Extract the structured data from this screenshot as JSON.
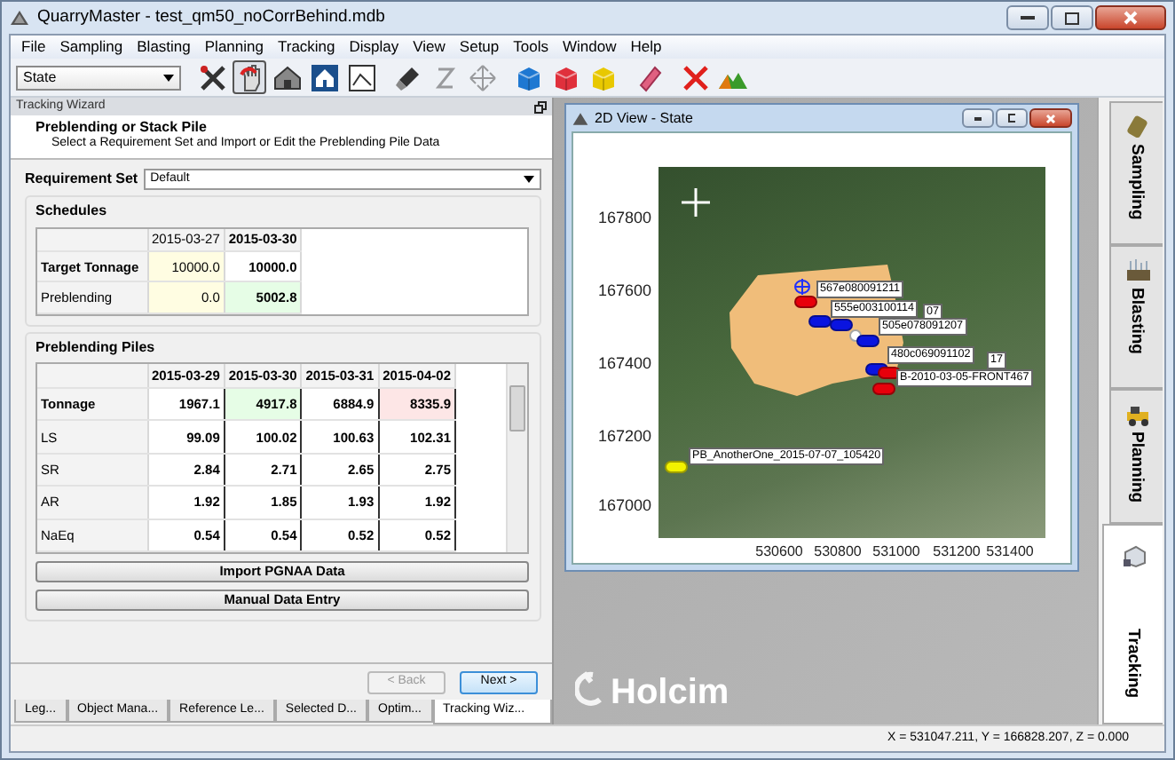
{
  "window": {
    "title": "QuarryMaster - test_qm50_noCorrBehind.mdb"
  },
  "menu": [
    "File",
    "Sampling",
    "Blasting",
    "Planning",
    "Tracking",
    "Display",
    "View",
    "Setup",
    "Tools",
    "Window",
    "Help"
  ],
  "toolbar": {
    "combo": "State",
    "buttons": [
      {
        "kind": "tools",
        "pressed": false,
        "disabled": false
      },
      {
        "kind": "hand",
        "pressed": true,
        "disabled": false
      },
      {
        "kind": "house",
        "pressed": false,
        "disabled": false
      },
      {
        "kind": "house-framed",
        "pressed": false,
        "disabled": false
      },
      {
        "kind": "frame",
        "pressed": false,
        "disabled": false
      },
      {
        "kind": "flashlight",
        "pressed": false,
        "disabled": false
      },
      {
        "kind": "zaxis",
        "pressed": false,
        "disabled": true
      },
      {
        "kind": "move",
        "pressed": false,
        "disabled": true
      },
      {
        "kind": "cube",
        "pressed": false,
        "disabled": false,
        "color": "#1e78d2"
      },
      {
        "kind": "cube",
        "pressed": false,
        "disabled": false,
        "color": "#e0303c"
      },
      {
        "kind": "cube",
        "pressed": false,
        "disabled": false,
        "color": "#e8c800"
      },
      {
        "kind": "eraser",
        "pressed": false,
        "disabled": false
      },
      {
        "kind": "delete",
        "pressed": false,
        "disabled": false
      },
      {
        "kind": "terrain",
        "pressed": false,
        "disabled": false
      }
    ]
  },
  "tracking_wizard": {
    "panel_title": "Tracking Wizard",
    "step_title": "Preblending or Stack Pile",
    "step_description": "Select a Requirement Set and Import or Edit the Preblending Pile Data",
    "requirement_set": {
      "label": "Requirement Set",
      "value": "Default"
    },
    "schedules": {
      "title": "Schedules",
      "columns": [
        {
          "text": "2015-03-27",
          "bold": false
        },
        {
          "text": "2015-03-30",
          "bold": true
        }
      ],
      "rows": [
        {
          "label": "Target Tonnage",
          "bold": true,
          "cells": [
            {
              "text": "10000.0",
              "bold": false,
              "color": "#fffde2"
            },
            {
              "text": "10000.0",
              "bold": true,
              "color": "#ffffff"
            }
          ]
        },
        {
          "label": "Preblending",
          "bold": false,
          "cells": [
            {
              "text": "0.0",
              "bold": false,
              "color": "#fffde2"
            },
            {
              "text": "5002.8",
              "bold": true,
              "color": "#e6fde6"
            }
          ]
        }
      ]
    },
    "piles": {
      "title": "Preblending Piles",
      "columns": [
        {
          "text": "2015-03-29",
          "bold": true
        },
        {
          "text": "2015-03-30",
          "bold": true
        },
        {
          "text": "2015-03-31",
          "bold": true
        },
        {
          "text": "2015-04-02",
          "bold": true
        }
      ],
      "rows": [
        {
          "label": "Tonnage",
          "bold": true,
          "cells": [
            {
              "text": "1967.1",
              "bold": true,
              "color": "#ffffff"
            },
            {
              "text": "4917.8",
              "bold": true,
              "color": "#e6fde6"
            },
            {
              "text": "6884.9",
              "bold": true,
              "color": "#ffffff"
            },
            {
              "text": "8335.9",
              "bold": true,
              "color": "#fde6e6"
            }
          ]
        },
        {
          "label": "LS",
          "bold": false,
          "cells": [
            {
              "text": "99.09",
              "bold": true,
              "color": "#ffffff"
            },
            {
              "text": "100.02",
              "bold": true,
              "color": "#ffffff"
            },
            {
              "text": "100.63",
              "bold": true,
              "color": "#ffffff"
            },
            {
              "text": "102.31",
              "bold": true,
              "color": "#ffffff"
            }
          ]
        },
        {
          "label": "SR",
          "bold": false,
          "cells": [
            {
              "text": "2.84",
              "bold": true,
              "color": "#ffffff"
            },
            {
              "text": "2.71",
              "bold": true,
              "color": "#ffffff"
            },
            {
              "text": "2.65",
              "bold": true,
              "color": "#ffffff"
            },
            {
              "text": "2.75",
              "bold": true,
              "color": "#ffffff"
            }
          ]
        },
        {
          "label": "AR",
          "bold": false,
          "cells": [
            {
              "text": "1.92",
              "bold": true,
              "color": "#ffffff"
            },
            {
              "text": "1.85",
              "bold": true,
              "color": "#ffffff"
            },
            {
              "text": "1.93",
              "bold": true,
              "color": "#ffffff"
            },
            {
              "text": "1.92",
              "bold": true,
              "color": "#ffffff"
            }
          ]
        },
        {
          "label": "NaEq",
          "bold": false,
          "cells": [
            {
              "text": "0.54",
              "bold": true,
              "color": "#ffffff"
            },
            {
              "text": "0.54",
              "bold": true,
              "color": "#ffffff"
            },
            {
              "text": "0.52",
              "bold": true,
              "color": "#ffffff"
            },
            {
              "text": "0.52",
              "bold": true,
              "color": "#ffffff"
            }
          ]
        }
      ]
    },
    "actions": [
      "Import PGNAA Data",
      "Manual Data Entry"
    ],
    "navigation": [
      {
        "label": "< Back",
        "disabled": true,
        "default": false
      },
      {
        "label": "Next >",
        "disabled": false,
        "default": true
      }
    ]
  },
  "bottom_tabs": [
    {
      "label": "Leg...",
      "selected": false
    },
    {
      "label": "Object Mana...",
      "selected": false
    },
    {
      "label": "Reference Le...",
      "selected": false
    },
    {
      "label": "Selected D...",
      "selected": false
    },
    {
      "label": "Optim...",
      "selected": false
    },
    {
      "label": "Tracking Wiz...",
      "selected": true
    }
  ],
  "map_view": {
    "title": "2D View - State",
    "y_ticks": [
      "167800",
      "167600",
      "167400",
      "167200",
      "167000"
    ],
    "x_ticks": [
      "530600",
      "530800",
      "531000",
      "531200",
      "531400"
    ],
    "markers": [
      {
        "color": "#e8000b"
      },
      {
        "color": "#0a14e0"
      },
      {
        "color": "#0a14e0"
      },
      {
        "color": "#ffffff"
      },
      {
        "color": "#0a14e0"
      },
      {
        "color": "#0a14e0"
      },
      {
        "color": "#e8000b"
      },
      {
        "color": "#e8000b"
      },
      {
        "color": "#f2f200"
      }
    ],
    "labels": [
      "567e080091211",
      "07",
      "555e003100114",
      "505e078091207",
      "17",
      "480c069091102",
      "B-2010-03-05-FRONT467",
      "PB_AnotherOne_2015-07-07_105420"
    ]
  },
  "background_logo": "Holcim",
  "side_tabs": [
    {
      "kind": "sampling",
      "label": "Sampling",
      "selected": false
    },
    {
      "kind": "blasting",
      "label": "Blasting",
      "selected": false
    },
    {
      "kind": "planning",
      "label": "Planning",
      "selected": false
    },
    {
      "kind": "tracking",
      "label": "Tracking",
      "selected": true
    }
  ],
  "status_bar": "X = 531047.211, Y = 166828.207, Z = 0.000"
}
